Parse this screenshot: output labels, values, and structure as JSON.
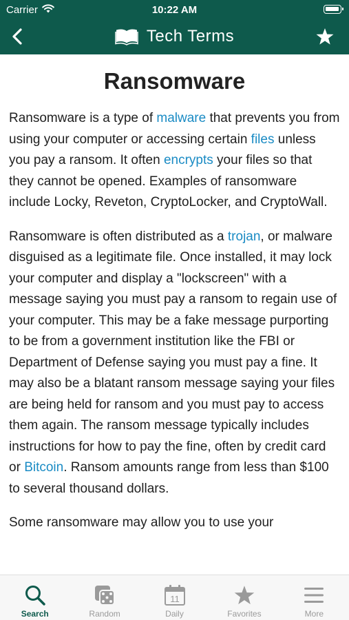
{
  "status": {
    "carrier": "Carrier",
    "time": "10:22 AM"
  },
  "nav": {
    "title": "Tech Terms"
  },
  "article": {
    "title": "Ransomware",
    "p1": {
      "t1": "Ransomware is a type of ",
      "link1": "malware",
      "t2": " that prevents you from using your computer or accessing certain ",
      "link2": "files",
      "t3": " unless you pay a ransom. It often ",
      "link3": "encrypts",
      "t4": " your files so that they cannot be opened. Examples of ransomware include Locky, Reveton, CryptoLocker, and CryptoWall."
    },
    "p2": {
      "t1": "Ransomware is often distributed as a ",
      "link1": "trojan",
      "t2": ", or malware disguised as a legitimate file. Once installed, it may lock your computer and display a \"lockscreen\" with a message saying you must pay a ransom to regain use of your computer. This may be a fake message purporting to be from a government institution like the FBI or Department of Defense saying you must pay a fine. It may also be a blatant ransom message saying your files are being held for ransom and you must pay to access them again. The ransom message typically includes instructions for how to pay the fine, often by credit card or ",
      "link2": "Bitcoin",
      "t3": ". Ransom amounts range from less than $100 to several thousand dollars."
    },
    "p3": {
      "t1": "Some ransomware may allow you to use your"
    }
  },
  "tabs": [
    {
      "label": "Search",
      "icon": "search-icon",
      "active": true
    },
    {
      "label": "Random",
      "icon": "dice-icon",
      "active": false
    },
    {
      "label": "Daily",
      "icon": "calendar-icon",
      "active": false
    },
    {
      "label": "Favorites",
      "icon": "star-icon",
      "active": false
    },
    {
      "label": "More",
      "icon": "menu-icon",
      "active": false
    }
  ],
  "calendar_day": "11",
  "colors": {
    "header": "#0e5a4c",
    "link": "#1a8bc4",
    "tab_inactive": "#9a9a9a",
    "tab_active": "#0e5a4c"
  }
}
